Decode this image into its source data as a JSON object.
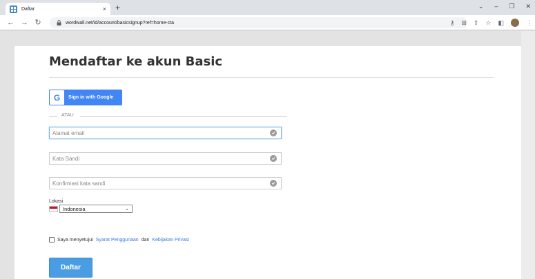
{
  "browser": {
    "tab_title": "Daftar",
    "tab_close": "×",
    "new_tab": "+",
    "url": "wordwall.net/id/account/basicsignup?ref=home-cta"
  },
  "page": {
    "title": "Mendaftar ke akun Basic",
    "google_button_label": "Sign in with Google",
    "google_letter": "G",
    "or_text": "ATAU",
    "fields": {
      "email_placeholder": "Alamat email",
      "password_placeholder": "Kata Sandi",
      "confirm_placeholder": "Konfirmasi kata sandi"
    },
    "location_label": "Lokasi",
    "country_selected": "Indonesia",
    "terms": {
      "prefix": "Saya menyetujui",
      "terms_link": "Syarat Penggunaan",
      "and": "dan",
      "privacy_link": "Kebijakan Privasi"
    },
    "submit_label": "Daftar"
  },
  "colors": {
    "google_blue": "#4285f4",
    "submit_blue": "#4a9de3",
    "link_blue": "#3a7bd5",
    "flag_red": "#ce1126"
  },
  "icons": [
    "wordwall-favicon-icon",
    "close-icon",
    "plus-icon",
    "back-icon",
    "forward-icon",
    "reload-icon",
    "lock-icon",
    "key-icon",
    "translate-icon",
    "share-icon",
    "star-icon",
    "sidebar-icon",
    "avatar-icon",
    "menu-icon",
    "check-circle-icon",
    "chevron-down-icon",
    "flag-indonesia-icon"
  ]
}
